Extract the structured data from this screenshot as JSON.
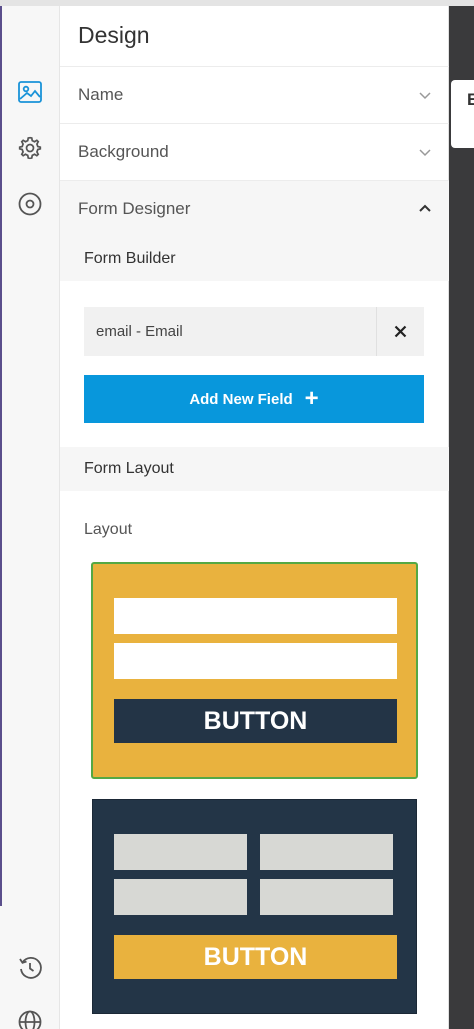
{
  "panel": {
    "title": "Design"
  },
  "accordion": {
    "name_label": "Name",
    "background_label": "Background",
    "form_designer_label": "Form Designer"
  },
  "form_builder": {
    "header": "Form Builder",
    "fields": [
      {
        "label": "email - Email"
      }
    ],
    "add_button_label": "Add New Field"
  },
  "form_layout": {
    "header": "Form Layout",
    "layout_label": "Layout",
    "options": [
      {
        "button_text": "BUTTON",
        "selected": true,
        "bg_color": "#e9b23e",
        "button_color": "#233446"
      },
      {
        "button_text": "BUTTON",
        "selected": false,
        "bg_color": "#233547",
        "button_color": "#e9b23e"
      }
    ]
  },
  "rail": {
    "icons": [
      "image-icon",
      "gear-icon",
      "target-icon",
      "history-icon",
      "globe-icon"
    ]
  },
  "right_tab": {
    "text": "E"
  },
  "colors": {
    "accent_blue": "#0897dc",
    "selected_border": "#55a844"
  }
}
